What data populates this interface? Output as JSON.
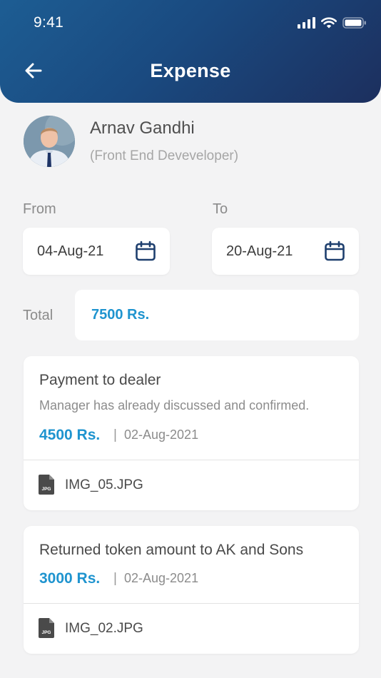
{
  "status_bar": {
    "time": "9:41"
  },
  "header": {
    "title": "Expense"
  },
  "icons": {
    "back": "arrow-left-icon",
    "calendar": "calendar-icon",
    "file": "jpg-file-icon",
    "signal": "cellular-signal-icon",
    "wifi": "wifi-icon",
    "battery": "battery-icon"
  },
  "employee": {
    "name": "Arnav Gandhi",
    "role": "(Front End Deveveloper)"
  },
  "filters": {
    "from_label": "From",
    "from_value": "04-Aug-21",
    "to_label": "To",
    "to_value": "20-Aug-21"
  },
  "total": {
    "label": "Total",
    "value": "7500 Rs."
  },
  "expenses": [
    {
      "title": "Payment to dealer",
      "description": "Manager has already discussed and confirmed.",
      "amount": "4500 Rs.",
      "separator": "|",
      "date": "02-Aug-2021",
      "attachment": "IMG_05.JPG",
      "file_badge": "JPG"
    },
    {
      "title": "Returned token amount to AK and Sons",
      "amount": "3000 Rs.",
      "separator": "|",
      "date": "02-Aug-2021",
      "attachment": "IMG_02.JPG",
      "file_badge": "JPG"
    }
  ],
  "colors": {
    "header_start": "#1d5d93",
    "header_end": "#1c2f5e",
    "accent": "#1f94cf",
    "background": "#f3f3f4",
    "icon_navy": "#1e3f6e"
  }
}
